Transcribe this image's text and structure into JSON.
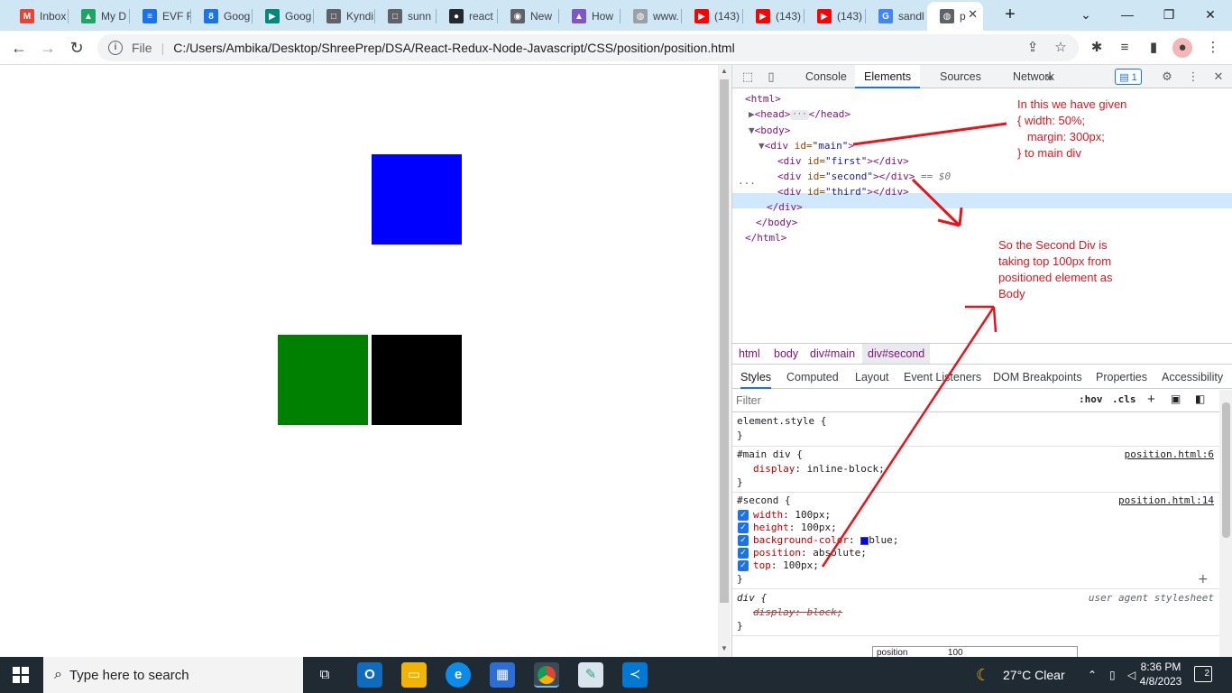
{
  "browser": {
    "tabs": [
      {
        "title": "Inbox",
        "icon": "gmail-icon",
        "color": "#ea4335",
        "glyph": "M"
      },
      {
        "title": "My D",
        "icon": "drive-icon",
        "color": "#1fa463",
        "glyph": "▲"
      },
      {
        "title": "EVF F",
        "icon": "forms-icon",
        "color": "#1a73e8",
        "glyph": "≡"
      },
      {
        "title": "Goog",
        "icon": "calendar-icon",
        "color": "#1a73e8",
        "glyph": "8"
      },
      {
        "title": "Goog",
        "icon": "meet-icon",
        "color": "#00897b",
        "glyph": "▶"
      },
      {
        "title": "Kyndi",
        "icon": "page-icon",
        "color": "#5f6368",
        "glyph": "□"
      },
      {
        "title": "sunn",
        "icon": "page-icon",
        "color": "#5f6368",
        "glyph": "□"
      },
      {
        "title": "react",
        "icon": "github-icon",
        "color": "#24292e",
        "glyph": "●"
      },
      {
        "title": "New",
        "icon": "chrome-icon",
        "color": "#5f6368",
        "glyph": "◉"
      },
      {
        "title": "How",
        "icon": "rocket-icon",
        "color": "#7e57c2",
        "glyph": "▲"
      },
      {
        "title": "www.",
        "icon": "globe-icon",
        "color": "#9aa0a6",
        "glyph": "◍"
      },
      {
        "title": "(143)",
        "icon": "youtube-icon",
        "color": "#ff0000",
        "glyph": "▶"
      },
      {
        "title": "(143)",
        "icon": "youtube-icon",
        "color": "#ff0000",
        "glyph": "▶"
      },
      {
        "title": "(143)",
        "icon": "youtube-icon",
        "color": "#ff0000",
        "glyph": "▶"
      },
      {
        "title": "sandl",
        "icon": "google-icon",
        "color": "#4285f4",
        "glyph": "G"
      },
      {
        "title": "p",
        "icon": "globe-icon",
        "color": "#5f6368",
        "glyph": "◍",
        "active": true
      }
    ],
    "new_tab": "+",
    "address": {
      "scheme_label": "File",
      "url": "C:/Users/Ambika/Desktop/ShreePrep/DSA/React-Redux-Node-Javascript/CSS/position/position.html"
    }
  },
  "page": {
    "squares": [
      {
        "name": "blue-square",
        "color": "#0000ff"
      },
      {
        "name": "green-square",
        "color": "#008000"
      },
      {
        "name": "black-square",
        "color": "#000000"
      }
    ]
  },
  "devtools": {
    "tabs": [
      "Console",
      "Elements",
      "Sources",
      "Network"
    ],
    "more": "»",
    "issues_count": "1",
    "dom": {
      "html_open": "<html>",
      "head": "<head>",
      "head_close": "</head>",
      "body_open": "<body>",
      "main_div_open": "<div",
      "attr_id": "id=",
      "main_id": "\"main\"",
      "first_id": "\"first\"",
      "second_id": "\"second\"",
      "third_id": "\"third\"",
      "gt": ">",
      "div_close": "</div>",
      "body_close": "</body>",
      "html_close": "</html>",
      "selected_marker": "== $0",
      "row_menu": "···",
      "ellipsis": "···"
    },
    "breadcrumbs": [
      "html",
      "body",
      "div#main",
      "div#second"
    ],
    "subtabs": [
      "Styles",
      "Computed",
      "Layout",
      "Event Listeners",
      "DOM Breakpoints",
      "Properties",
      "Accessibility"
    ],
    "filter": {
      "placeholder": "Filter",
      "hov": ":hov",
      "cls": ".cls"
    },
    "styles": {
      "element_style": "element.style {",
      "close": "}",
      "main_div_selector": "#main div {",
      "main_div_source": "position.html:6",
      "display_prop": "display",
      "display_val": "inline-block;",
      "second_selector": "#second {",
      "second_source": "position.html:14",
      "second_props": [
        {
          "prop": "width",
          "val": "100px;"
        },
        {
          "prop": "height",
          "val": "100px;"
        },
        {
          "prop": "background-color",
          "val": "blue;",
          "swatch": "#0000ff"
        },
        {
          "prop": "position",
          "val": "absolute;"
        },
        {
          "prop": "top",
          "val": "100px;"
        }
      ],
      "ua_selector": "div {",
      "ua_source": "user agent stylesheet",
      "ua_decl": "display: block;",
      "bottom_partial": "position                100"
    },
    "annotations": {
      "top_note": "In this we have given\n{ width: 50%;\n   margin: 300px;\n} to main div",
      "bottom_note": "So the Second Div is\ntaking top 100px from\npositioned element as\nBody"
    }
  },
  "taskbar": {
    "search_placeholder": "Type here to search",
    "weather": "27°C  Clear",
    "time": "8:36 PM",
    "date": "4/8/2023",
    "notifications": "2"
  }
}
